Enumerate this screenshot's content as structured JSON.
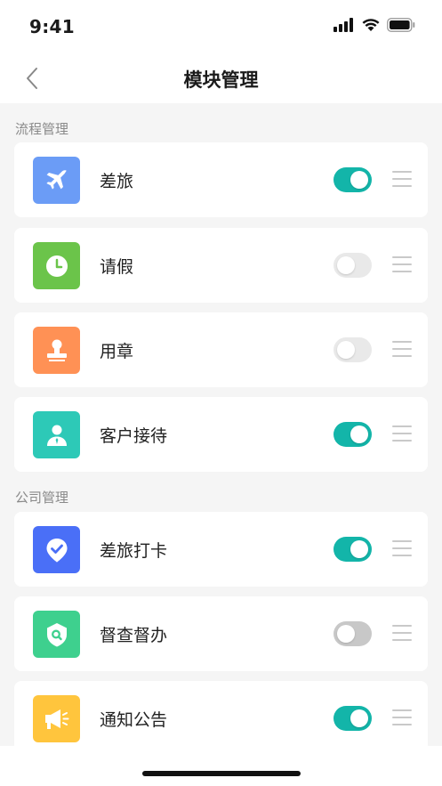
{
  "status_bar": {
    "time": "9:41"
  },
  "nav": {
    "title": "模块管理"
  },
  "sections": [
    {
      "label": "流程管理"
    },
    {
      "label": "公司管理"
    }
  ],
  "items": [
    {
      "label": "差旅",
      "enabled": true,
      "icon": "airplane-icon",
      "color": "#6b9cf6"
    },
    {
      "label": "请假",
      "enabled": false,
      "icon": "clock-icon",
      "color": "#6bc44a"
    },
    {
      "label": "用章",
      "enabled": false,
      "icon": "stamp-icon",
      "color": "#ff9155"
    },
    {
      "label": "客户接待",
      "enabled": true,
      "icon": "person-icon",
      "color": "#2dc9b7"
    },
    {
      "label": "差旅打卡",
      "enabled": true,
      "icon": "check-pin-icon",
      "color": "#4a6ff7"
    },
    {
      "label": "督查督办",
      "enabled": false,
      "icon": "shield-search-icon",
      "color": "#3ed08e"
    },
    {
      "label": "通知公告",
      "enabled": true,
      "icon": "megaphone-icon",
      "color": "#ffc53d"
    }
  ],
  "colors": {
    "toggle_on": "#13b5a9",
    "toggle_off": "#e9e9e9"
  }
}
